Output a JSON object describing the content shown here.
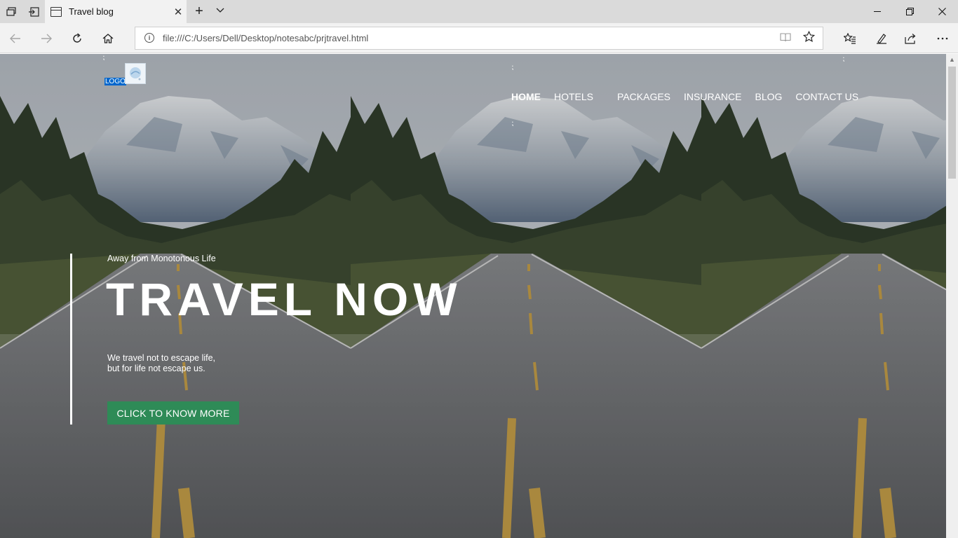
{
  "browser": {
    "tab_title": "Travel blog",
    "url": "file:///C:/Users/Dell/Desktop/notesabc/prjtravel.html"
  },
  "page": {
    "logo_text": "LOGO",
    "nav": [
      "HOME",
      "HOTELS",
      "PACKAGES",
      "INSURANCE",
      "BLOG",
      "CONTACT US"
    ],
    "active_nav": "HOME",
    "subtitle": "Away from Monotonous Life",
    "headline": "TRAVEL NOW",
    "quote_line1": "We travel not to escape life,",
    "quote_line2": "but for life not escape us.",
    "cta_label": "CLICK TO KNOW MORE"
  },
  "colors": {
    "cta": "#2e8b57",
    "logo_highlight": "#0066cc",
    "tabbar": "#dadada",
    "toolbar": "#f2f2f2"
  },
  "icons": {
    "tab_actions": "tab-preview-icon",
    "set_aside": "set-aside-tabs-icon",
    "page": "page-icon",
    "close": "close-icon",
    "new_tab": "plus-icon",
    "tab_list": "chevron-down-icon",
    "minimize": "minimize-icon",
    "restore": "restore-icon",
    "window_close": "window-close-icon",
    "back": "back-arrow-icon",
    "forward": "forward-arrow-icon",
    "refresh": "refresh-icon",
    "home": "home-icon",
    "info": "info-icon",
    "reading_view": "reading-view-icon",
    "favorite": "star-icon",
    "favorites_hub": "favorites-hub-icon",
    "notes": "pen-icon",
    "share": "share-icon",
    "more": "more-icon"
  }
}
